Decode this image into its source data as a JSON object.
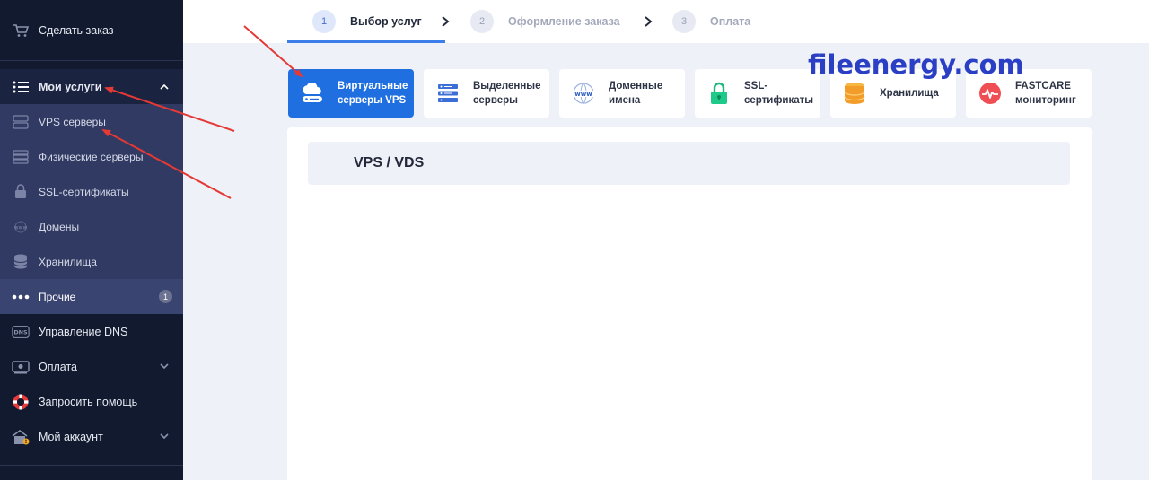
{
  "sidebar": {
    "order": "Сделать заказ",
    "services": "Мои услуги",
    "sub": {
      "vps": "VPS серверы",
      "dedicated": "Физические серверы",
      "ssl": "SSL-сертификаты",
      "domains": "Домены",
      "storage": "Хранилища",
      "other": "Прочие",
      "other_badge": "1"
    },
    "dns": "Управление DNS",
    "billing": "Оплата",
    "support": "Запросить помощь",
    "account": "Мой аккаунт"
  },
  "stepper": {
    "steps": [
      {
        "num": "1",
        "label": "Выбор услуг"
      },
      {
        "num": "2",
        "label": "Оформление заказа"
      },
      {
        "num": "3",
        "label": "Оплата"
      }
    ]
  },
  "categories": [
    {
      "label": "Виртуальные\nсерверы VPS",
      "icon": "cloud-server-icon"
    },
    {
      "label": "Выделенные\nсерверы",
      "icon": "server-rack-icon"
    },
    {
      "label": "Доменные\nимена",
      "icon": "www-globe-icon"
    },
    {
      "label": "SSL-\nсертификаты",
      "icon": "lock-icon"
    },
    {
      "label": "Хранилища",
      "icon": "storage-icon"
    },
    {
      "label": "FASTCARE\nмониторинг",
      "icon": "pulse-icon"
    }
  ],
  "main": {
    "section_title": "VPS / VDS"
  },
  "watermark": "fileenergy.com",
  "colors": {
    "sidebar_bg": "#111a2e",
    "sidebar_sub_bg": "#303a63",
    "accent": "#1f6fe0",
    "annotation_arrow": "#e53935"
  }
}
